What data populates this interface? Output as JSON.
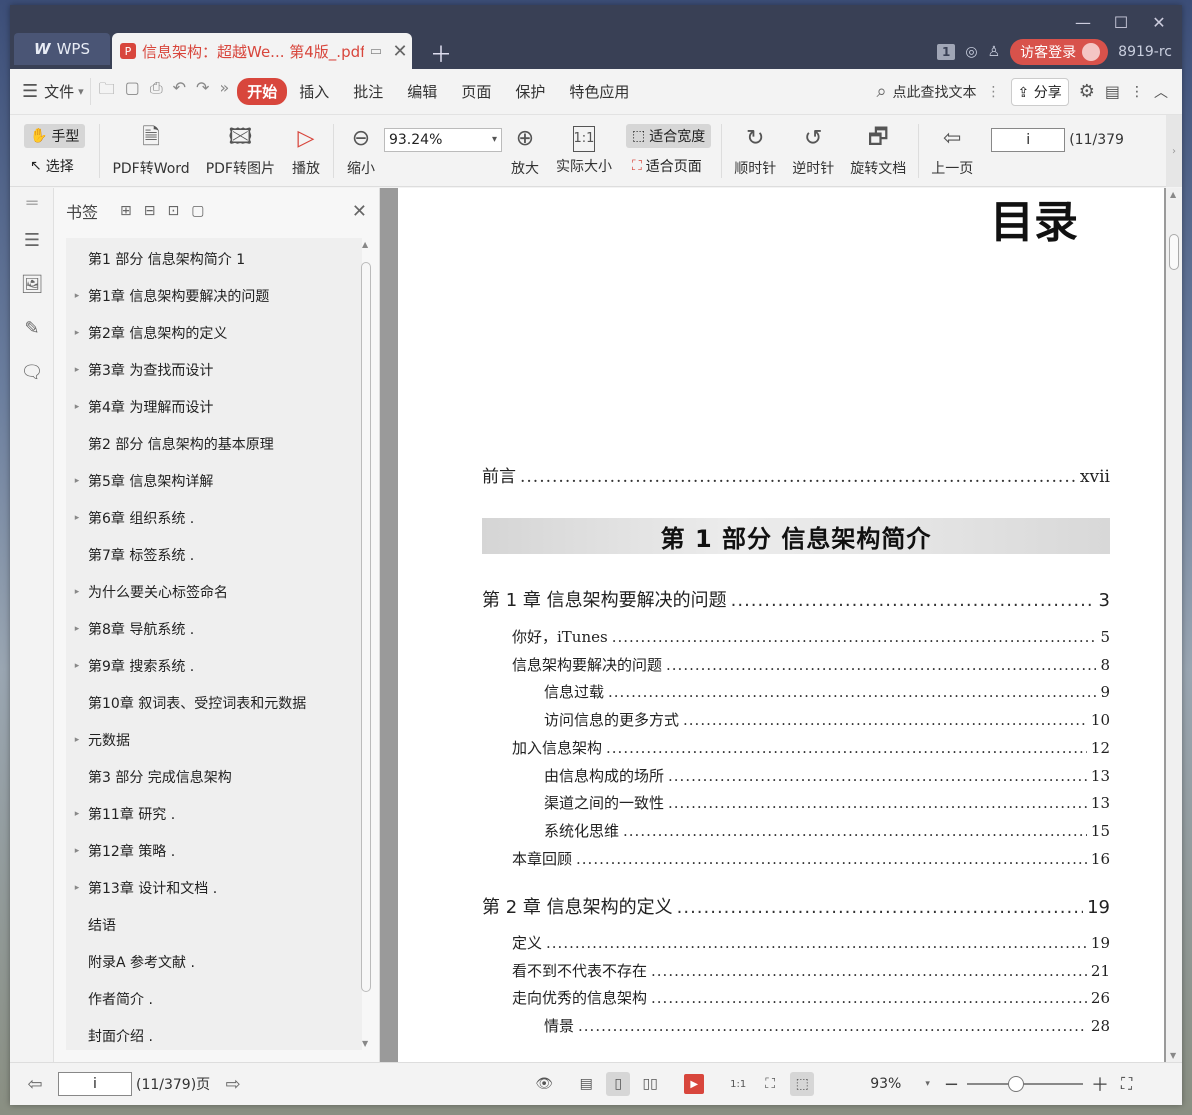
{
  "titlebar": {
    "app_tab": "WPS",
    "doc_tab": "信息架构：超越We... 第4版_.pdf",
    "badge": "1",
    "login": "访客登录",
    "version": "8919-rc"
  },
  "menu": {
    "file": "文件",
    "items": [
      "开始",
      "插入",
      "批注",
      "编辑",
      "页面",
      "保护",
      "特色应用"
    ],
    "search": "点此查找文本",
    "share": "分享"
  },
  "toolbar": {
    "hand": "手型",
    "select": "选择",
    "pdf_to_word": "PDF转Word",
    "pdf_to_image": "PDF转图片",
    "play": "播放",
    "zoom_out": "缩小",
    "zoom_value": "93.24%",
    "zoom_in": "放大",
    "actual_size": "实际大小",
    "fit_width": "适合宽度",
    "fit_page": "适合页面",
    "rotate_cw": "顺时针",
    "rotate_ccw": "逆时针",
    "rotate_doc": "旋转文档",
    "prev_page": "上一页",
    "page_value": "i",
    "page_count": "(11/379"
  },
  "bookmarks": {
    "title": "书签",
    "items": [
      {
        "label": "第1 部分 信息架构简介  1",
        "expandable": false
      },
      {
        "label": "第1章 信息架构要解决的问题",
        "expandable": true
      },
      {
        "label": "第2章 信息架构的定义",
        "expandable": true
      },
      {
        "label": "第3章 为查找而设计",
        "expandable": true
      },
      {
        "label": "第4章 为理解而设计",
        "expandable": true
      },
      {
        "label": "第2 部分 信息架构的基本原理",
        "expandable": false
      },
      {
        "label": "第5章 信息架构详解",
        "expandable": true
      },
      {
        "label": "第6章 组织系统 .",
        "expandable": true
      },
      {
        "label": "第7章 标签系统 .",
        "expandable": false
      },
      {
        "label": "为什么要关心标签命名",
        "expandable": true
      },
      {
        "label": "第8章 导航系统 .",
        "expandable": true
      },
      {
        "label": "第9章 搜索系统 .",
        "expandable": true
      },
      {
        "label": "第10章 叙词表、受控词表和元数据",
        "expandable": false
      },
      {
        "label": "元数据",
        "expandable": true
      },
      {
        "label": "第3 部分 完成信息架构",
        "expandable": false
      },
      {
        "label": "第11章 研究 .",
        "expandable": true
      },
      {
        "label": "第12章 策略 .",
        "expandable": true
      },
      {
        "label": "第13章 设计和文档 .",
        "expandable": true
      },
      {
        "label": "结语",
        "expandable": false
      },
      {
        "label": "附录A 参考文献 .",
        "expandable": false
      },
      {
        "label": "作者简介 .",
        "expandable": false
      },
      {
        "label": "封面介绍 .",
        "expandable": false
      }
    ]
  },
  "document": {
    "title": "目录",
    "preface": {
      "t": "前言",
      "p": "xvii"
    },
    "part1": "第 1 部分  信息架构简介",
    "ch1": {
      "t": "第 1 章  信息架构要解决的问题",
      "p": "3"
    },
    "ch1_entries": [
      {
        "t": "你好，iTunes",
        "p": "5",
        "level": 1
      },
      {
        "t": "信息架构要解决的问题",
        "p": "8",
        "level": 1
      },
      {
        "t": "信息过载",
        "p": "9",
        "level": 2
      },
      {
        "t": "访问信息的更多方式",
        "p": "10",
        "level": 2
      },
      {
        "t": "加入信息架构",
        "p": "12",
        "level": 1
      },
      {
        "t": "由信息构成的场所",
        "p": "13",
        "level": 2
      },
      {
        "t": "渠道之间的一致性",
        "p": "13",
        "level": 2
      },
      {
        "t": "系统化思维",
        "p": "15",
        "level": 2
      },
      {
        "t": "本章回顾",
        "p": "16",
        "level": 1
      }
    ],
    "ch2": {
      "t": "第 2 章  信息架构的定义",
      "p": "19"
    },
    "ch2_entries": [
      {
        "t": "定义",
        "p": "19",
        "level": 1
      },
      {
        "t": "看不到不代表不存在",
        "p": "21",
        "level": 1
      },
      {
        "t": "走向优秀的信息架构",
        "p": "26",
        "level": 1
      },
      {
        "t": "情景",
        "p": "28",
        "level": 2
      }
    ]
  },
  "status": {
    "page_value": "i",
    "page_text": "(11/379)页",
    "zoom": "93%",
    "zoom_level": 0.42
  }
}
